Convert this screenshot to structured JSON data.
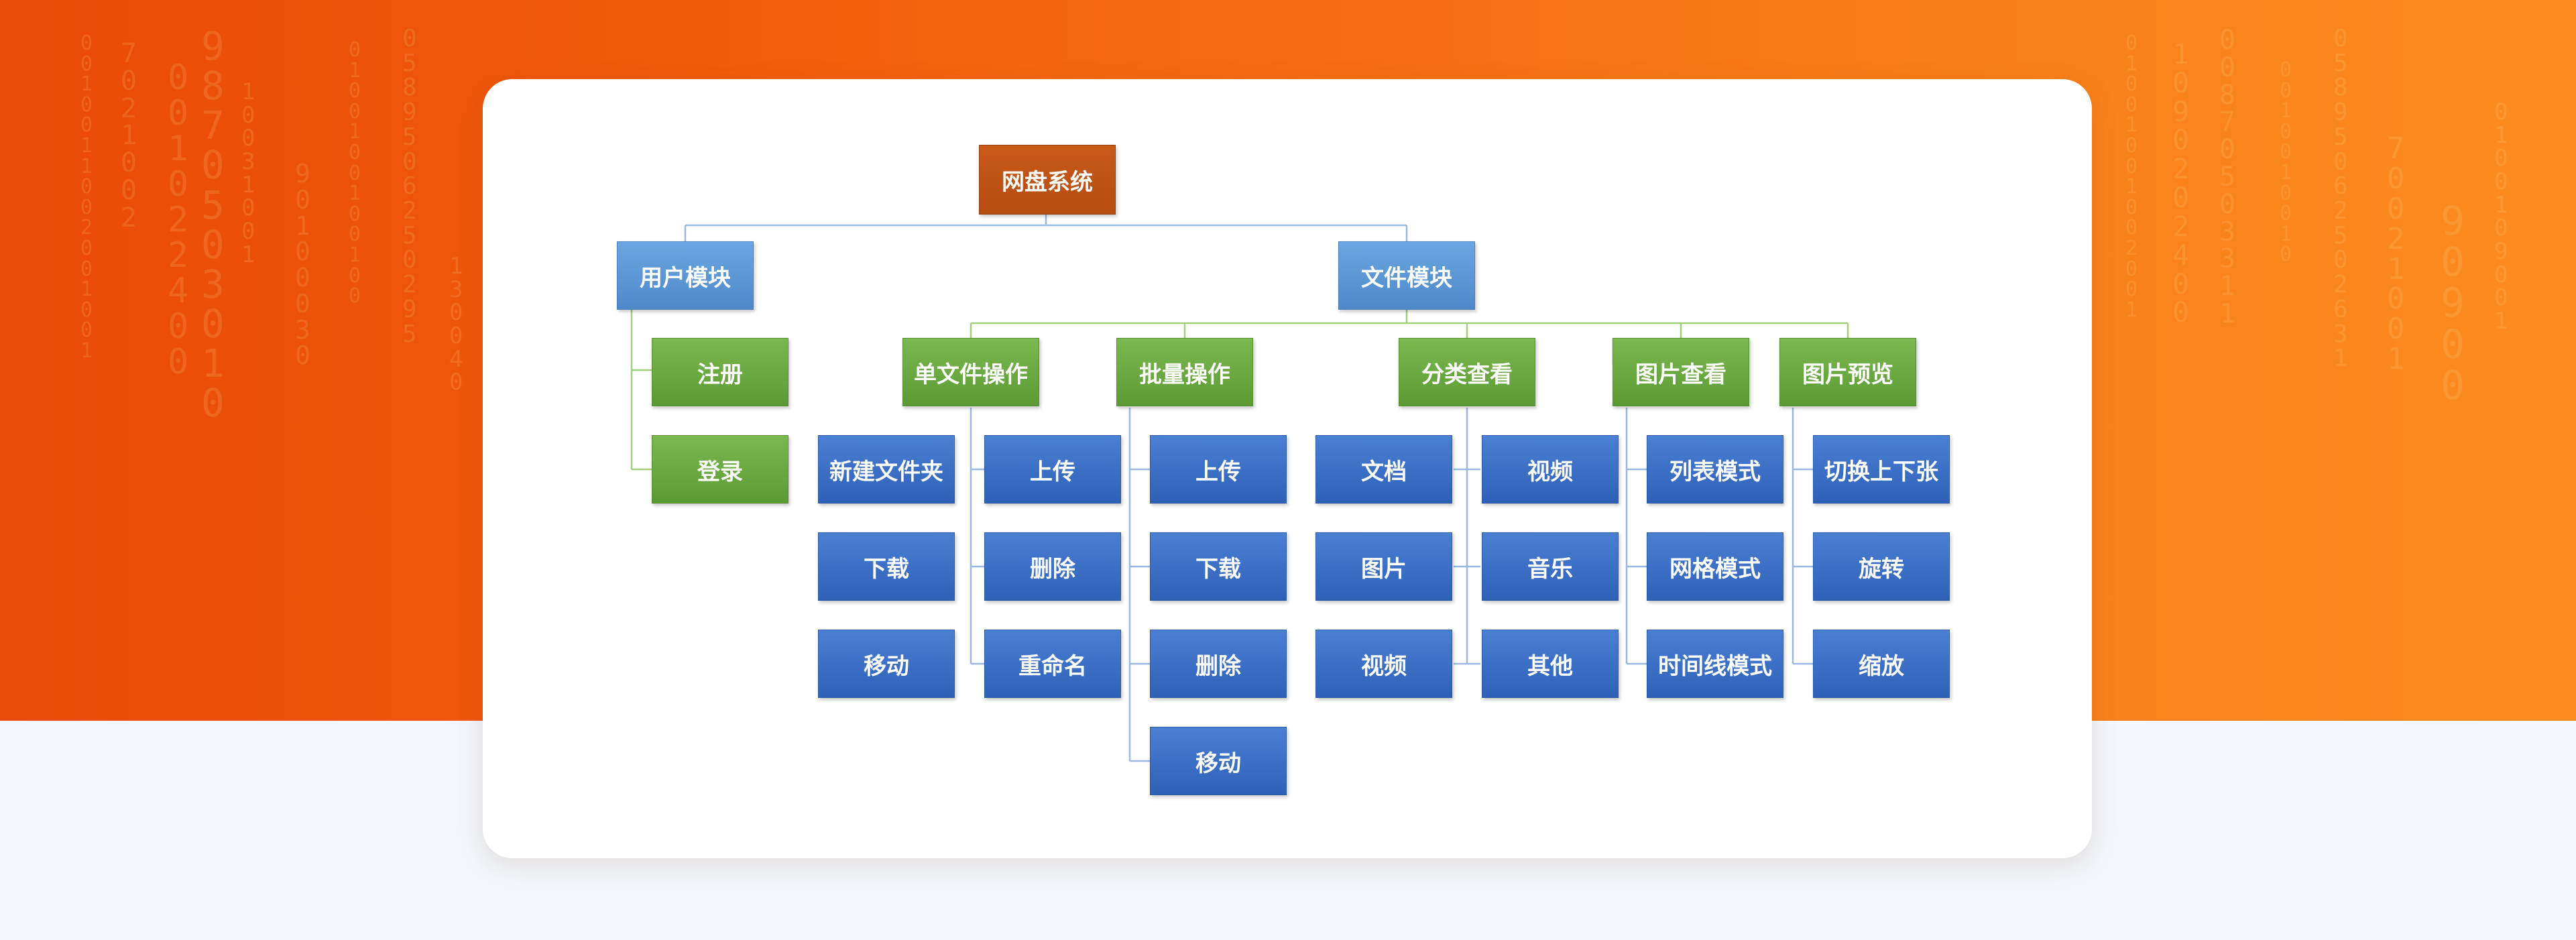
{
  "diagram": {
    "root": {
      "label": "网盘系统"
    },
    "user_module": {
      "label": "用户模块",
      "children": [
        "注册",
        "登录"
      ]
    },
    "file_module": {
      "label": "文件模块",
      "groups": [
        {
          "label": "单文件操作",
          "items": [
            "新建文件夹",
            "上传",
            "下载",
            "删除",
            "移动",
            "重命名"
          ]
        },
        {
          "label": "批量操作",
          "items": [
            "上传",
            "下载",
            "删除",
            "移动"
          ]
        },
        {
          "label": "分类查看",
          "items": [
            "文档",
            "视频",
            "图片",
            "音乐",
            "视频",
            "其他"
          ]
        },
        {
          "label": "图片查看",
          "items": [
            "列表模式",
            "网格模式",
            "时间线模式"
          ]
        },
        {
          "label": "图片预览",
          "items": [
            "切换上下张",
            "旋转",
            "缩放"
          ]
        }
      ]
    }
  },
  "colors": {
    "root": "#b8500f",
    "level1": "#5b94d3",
    "level2": "#66a43b",
    "leaf": "#3669c2",
    "link_blue": "#9ab8e4",
    "link_green": "#9fd07c",
    "banner_left": "#ea4a06",
    "banner_right": "#fb8d20",
    "card": "#ffffff",
    "page": "#f3f7fb"
  }
}
